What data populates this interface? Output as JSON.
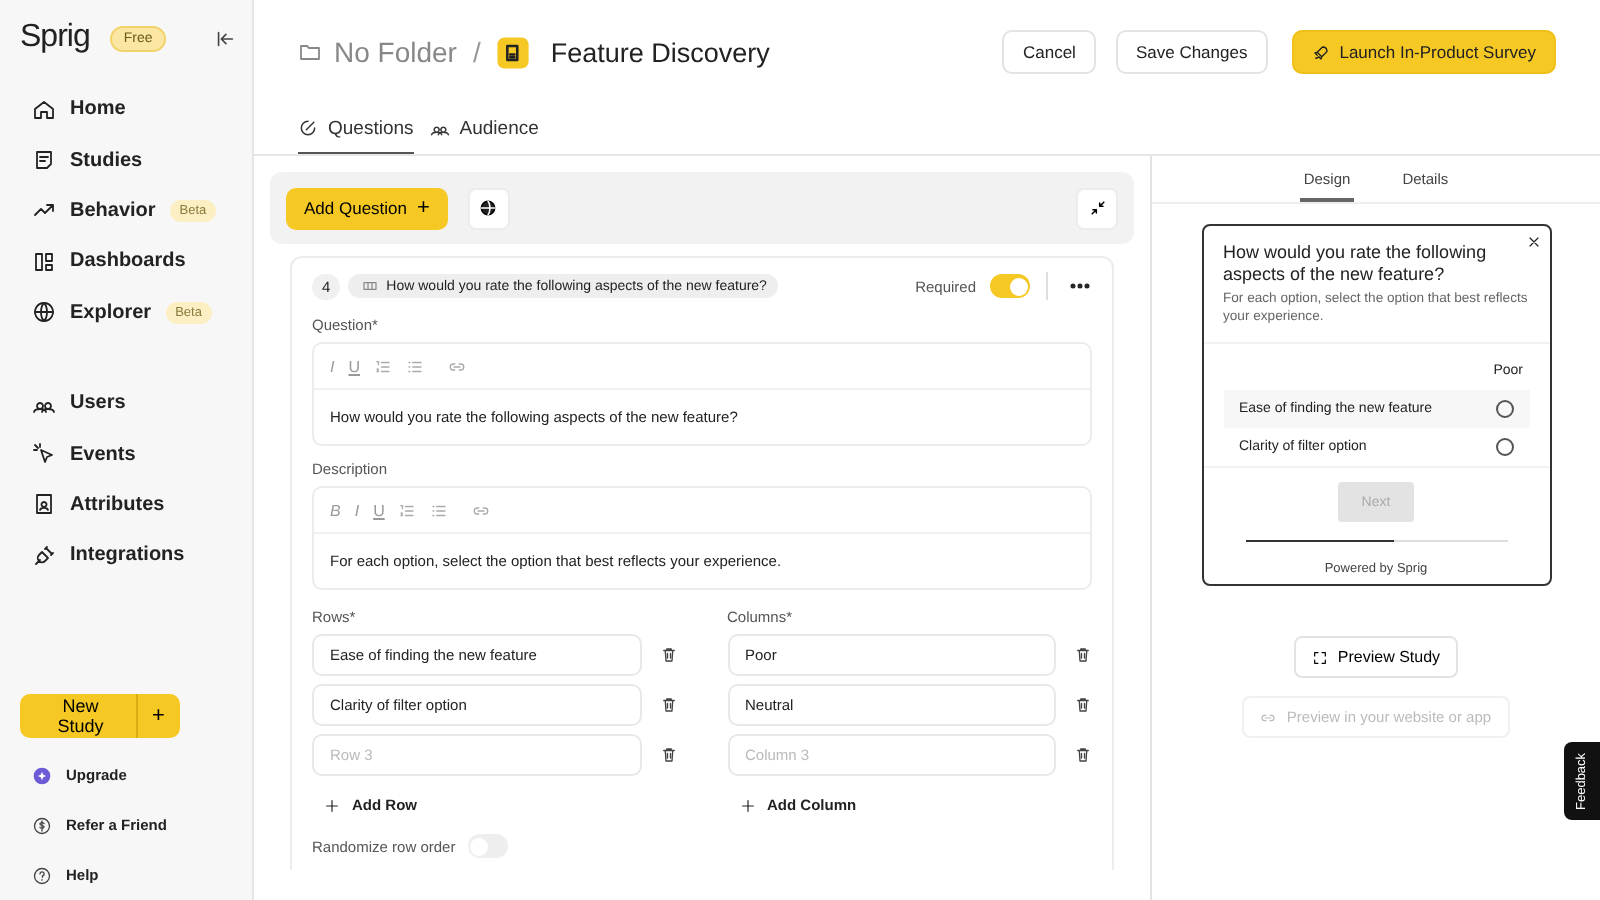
{
  "sidebar": {
    "logo": "Sprig",
    "plan_badge": "Free",
    "nav_groups": [
      [
        {
          "label": "Home"
        },
        {
          "label": "Studies"
        },
        {
          "label": "Behavior",
          "badge": "Beta"
        },
        {
          "label": "Dashboards"
        },
        {
          "label": "Explorer",
          "badge": "Beta"
        }
      ],
      [
        {
          "label": "Users"
        },
        {
          "label": "Events"
        },
        {
          "label": "Attributes"
        },
        {
          "label": "Integrations"
        }
      ]
    ],
    "new_study_button": "New Study",
    "new_study_plus": "+",
    "footer_links": [
      "Upgrade",
      "Refer a Friend",
      "Help"
    ]
  },
  "header": {
    "folder": "No Folder",
    "separator": "/",
    "title": "Feature Discovery",
    "buttons": [
      {
        "label": "Cancel",
        "kind": "secondary"
      },
      {
        "label": "Save Changes",
        "kind": "secondary"
      },
      {
        "label": "Launch In-Product Survey",
        "kind": "primary"
      }
    ]
  },
  "tabs": [
    {
      "label": "Questions",
      "selected": true
    },
    {
      "label": "Audience",
      "selected": false
    }
  ],
  "editor": {
    "add_question": "Add Question",
    "add_question_plus": "+",
    "question": {
      "number": "4",
      "summary": "How would you rate the following aspects of the new feature?",
      "required_label": "Required",
      "required": true,
      "question_label": "Question*",
      "question_format": [
        "I",
        "U"
      ],
      "question_text": "How would you rate the following aspects of the new feature?",
      "description_label": "Description",
      "description_format": [
        "B",
        "I",
        "U"
      ],
      "description_text": "For each option, select the option that best reflects your experience.",
      "rows_label": "Rows*",
      "rows": [
        {
          "value": "Ease of finding the new feature"
        },
        {
          "value": "Clarity of filter option"
        },
        {
          "placeholder": "Row 3"
        }
      ],
      "columns_label": "Columns*",
      "columns": [
        {
          "value": "Poor"
        },
        {
          "value": "Neutral"
        },
        {
          "placeholder": "Column 3"
        }
      ],
      "add_row": "Add Row",
      "add_column": "Add Column",
      "randomize_label": "Randomize row order",
      "randomize": false
    }
  },
  "preview": {
    "tabs": [
      {
        "label": "Design",
        "selected": true
      },
      {
        "label": "Details",
        "selected": false
      }
    ],
    "survey": {
      "title": "How would you rate the following aspects of the new feature?",
      "subtitle": "For each option, select the option that best reflects your experience.",
      "column_header": "Poor",
      "rows": [
        {
          "label": "Ease of finding the new feature",
          "selected": false
        },
        {
          "label": "Clarity of filter option",
          "selected": false
        }
      ],
      "next_button": {
        "label": "Next",
        "disabled": true
      },
      "progress": {
        "level": 0.57
      },
      "powered_by": "Powered by Sprig"
    },
    "preview_study": "Preview Study",
    "preview_site": "Preview in your website or app"
  },
  "feedback_tab": "Feedback"
}
